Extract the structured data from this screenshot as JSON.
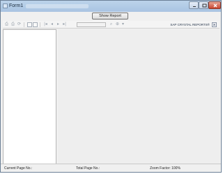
{
  "window": {
    "title": "Form1"
  },
  "buttons": {
    "show_report": "Show Report"
  },
  "toolbar": {
    "brand_text": "SAP CRYSTAL REPORTS®"
  },
  "status": {
    "current_page": "Current Page No.:",
    "total_page": "Total Page No.:",
    "zoom": "Zoom Factor: 100%"
  },
  "colors": {
    "titlebar": "#aac4e2",
    "window_bg": "#f0f0f0",
    "viewer_bg": "#eeeeee"
  },
  "icons": [
    "app-icon",
    "minimize-icon",
    "maximize-icon",
    "close-icon",
    "export-icon",
    "print-icon",
    "refresh-icon",
    "toggle-tree-icon",
    "first-page-icon",
    "previous-page-icon",
    "next-page-icon",
    "last-page-icon",
    "goto-page-input",
    "search-icon",
    "zoom-icon",
    "sap-logo-icon"
  ]
}
